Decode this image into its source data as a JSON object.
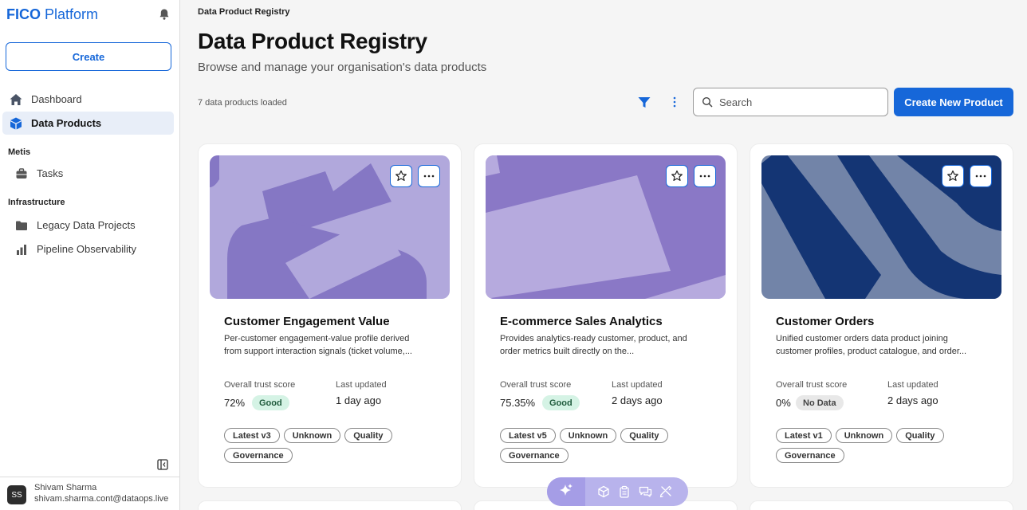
{
  "sidebar": {
    "brand_bold": "FICO",
    "brand_rest": "Platform",
    "create_label": "Create",
    "items": [
      {
        "label": "Dashboard",
        "icon": "home-icon"
      },
      {
        "label": "Data Products",
        "icon": "cube-icon",
        "active": true
      }
    ],
    "sections": [
      {
        "heading": "Metis",
        "items": [
          {
            "label": "Tasks",
            "icon": "briefcase-icon"
          }
        ]
      },
      {
        "heading": "Infrastructure",
        "items": [
          {
            "label": "Legacy Data Projects",
            "icon": "folder-icon"
          },
          {
            "label": "Pipeline Observability",
            "icon": "bar-chart-icon"
          }
        ]
      }
    ],
    "user": {
      "initials": "SS",
      "name": "Shivam Sharma",
      "email": "shivam.sharma.cont@dataops.live"
    }
  },
  "main": {
    "breadcrumb": "Data Product Registry",
    "title": "Data Product Registry",
    "subtitle": "Browse and manage your organisation's data products",
    "count_text": "7 data products loaded",
    "search_placeholder": "Search",
    "new_product_label": "Create New Product"
  },
  "labels": {
    "trust": "Overall trust score",
    "updated": "Last updated"
  },
  "cards": [
    {
      "title": "Customer Engagement Value",
      "desc_line1": "Per-customer engagement-value profile derived",
      "desc_line2": "from support interaction signals (ticket volume,...",
      "trust": "72%",
      "status": "Good",
      "updated": "1 day ago",
      "tags": [
        "Latest v3",
        "Unknown",
        "Quality",
        "Governance"
      ],
      "colors": {
        "bg": "#b1a8dc",
        "shape": "#8577c4"
      }
    },
    {
      "title": "E-commerce Sales Analytics",
      "desc_line1": "Provides analytics-ready customer, product, and",
      "desc_line2": "order metrics built directly on the...",
      "trust": "75.35%",
      "status": "Good",
      "updated": "2 days ago",
      "tags": [
        "Latest v5",
        "Unknown",
        "Quality",
        "Governance"
      ],
      "colors": {
        "bg": "#8a78c6",
        "shape": "#b6aade"
      }
    },
    {
      "title": "Customer Orders",
      "desc_line1": "Unified customer orders data product joining",
      "desc_line2": "customer profiles, product catalogue, and order...",
      "trust": "0%",
      "status": "No Data",
      "updated": "2 days ago",
      "tags": [
        "Latest v1",
        "Unknown",
        "Quality",
        "Governance"
      ],
      "colors": {
        "bg": "#7284a8",
        "shape": "#143574"
      }
    }
  ],
  "colors": {
    "accent": "#1667d9",
    "good_bg": "#d5f3e5",
    "nodata_bg": "#e8e8e8",
    "fab": "#b8b3ec"
  }
}
